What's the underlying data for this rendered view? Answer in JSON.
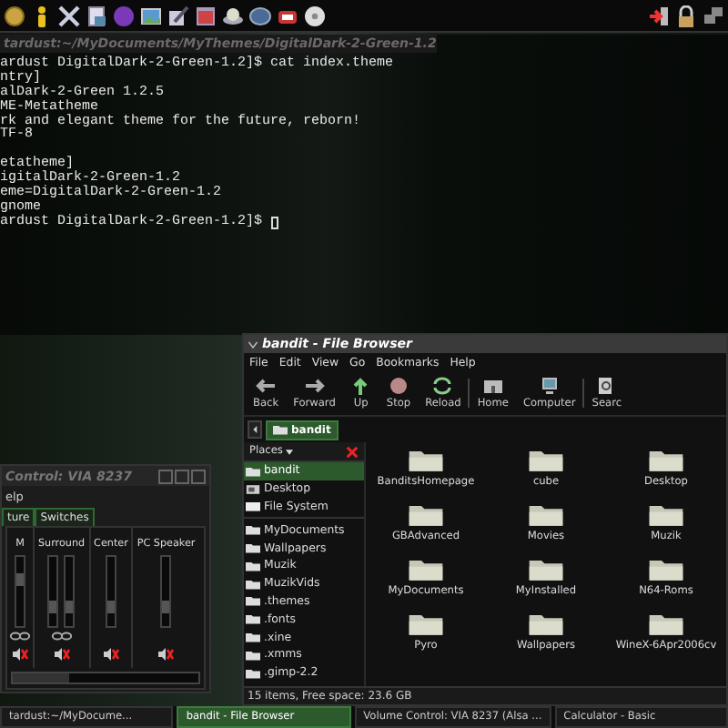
{
  "terminal": {
    "title": "tardust:~/MyDocuments/MyThemes/DigitalDark-2-Green-1.2",
    "blocks": [
      [
        "ardust DigitalDark-2-Green-1.2]$ cat index.theme",
        "ntry]",
        "alDark-2-Green 1.2.5",
        "ME-Metatheme",
        "rk and elegant theme for the future, reborn!",
        "TF-8"
      ],
      [
        "etatheme]",
        "igitalDark-2-Green-1.2",
        "eme=DigitalDark-2-Green-1.2",
        "gnome",
        "ardust DigitalDark-2-Green-1.2]$ "
      ]
    ]
  },
  "file_browser": {
    "title": "bandit - File Browser",
    "menu": [
      "File",
      "Edit",
      "View",
      "Go",
      "Bookmarks",
      "Help"
    ],
    "toolbar": [
      {
        "label": "Back",
        "kind": "back"
      },
      {
        "label": "Forward",
        "kind": "forward"
      },
      {
        "label": "Up",
        "kind": "up"
      },
      {
        "label": "Stop",
        "kind": "stop"
      },
      {
        "label": "Reload",
        "kind": "reload"
      },
      {
        "label": "Home",
        "kind": "home"
      },
      {
        "label": "Computer",
        "kind": "computer"
      },
      {
        "label": "Searc",
        "kind": "search"
      }
    ],
    "location": "bandit",
    "places_header": "Places",
    "places": [
      {
        "label": "bandit",
        "selected": true,
        "kind": "folder"
      },
      {
        "label": "Desktop",
        "selected": false,
        "kind": "desktop"
      },
      {
        "label": "File System",
        "selected": false,
        "kind": "drive"
      }
    ],
    "bookmarks": [
      {
        "label": "MyDocuments",
        "selected": false
      },
      {
        "label": "Wallpapers",
        "selected": false
      },
      {
        "label": "Muzik",
        "selected": false
      },
      {
        "label": "MuzikVids",
        "selected": false
      },
      {
        "label": ".themes",
        "selected": false
      },
      {
        "label": ".fonts",
        "selected": false
      },
      {
        "label": ".xine",
        "selected": false
      },
      {
        "label": ".xmms",
        "selected": false
      },
      {
        "label": ".gimp-2.2",
        "selected": false
      }
    ],
    "items": [
      {
        "name": "BanditsHomepage"
      },
      {
        "name": "cube"
      },
      {
        "name": "Desktop"
      },
      {
        "name": "GBAdvanced"
      },
      {
        "name": "Movies"
      },
      {
        "name": "Muzik"
      },
      {
        "name": "MyDocuments"
      },
      {
        "name": "MyInstalled"
      },
      {
        "name": "N64-Roms"
      },
      {
        "name": "Pyro"
      },
      {
        "name": "Wallpapers"
      },
      {
        "name": "WineX-6Apr2006cv"
      }
    ],
    "status": "15 items, Free space: 23.6 GB"
  },
  "volume_control": {
    "title": "Control: VIA 8237",
    "menu": [
      "elp"
    ],
    "tabs": [
      {
        "label": "ture",
        "selected": false
      },
      {
        "label": "Switches",
        "selected": false
      }
    ],
    "channels": [
      {
        "name": "M",
        "linked": true,
        "sliders": [
          {
            "level": 0.7
          }
        ]
      },
      {
        "name": "Surround",
        "linked": true,
        "sliders": [
          {
            "level": 0.22
          },
          {
            "level": 0.22
          }
        ]
      },
      {
        "name": "Center",
        "linked": false,
        "sliders": [
          {
            "level": 0.22
          }
        ]
      },
      {
        "name": "PC Speaker",
        "linked": false,
        "sliders": [
          {
            "level": 0.22
          }
        ]
      }
    ]
  },
  "taskbar": [
    {
      "label": "tardust:~/MyDocume...",
      "selected": false
    },
    {
      "label": "bandit - File Browser",
      "selected": true
    },
    {
      "label": "Volume Control: VIA 8237 (Alsa ...",
      "selected": false
    },
    {
      "label": "Calculator - Basic",
      "selected": false
    }
  ]
}
